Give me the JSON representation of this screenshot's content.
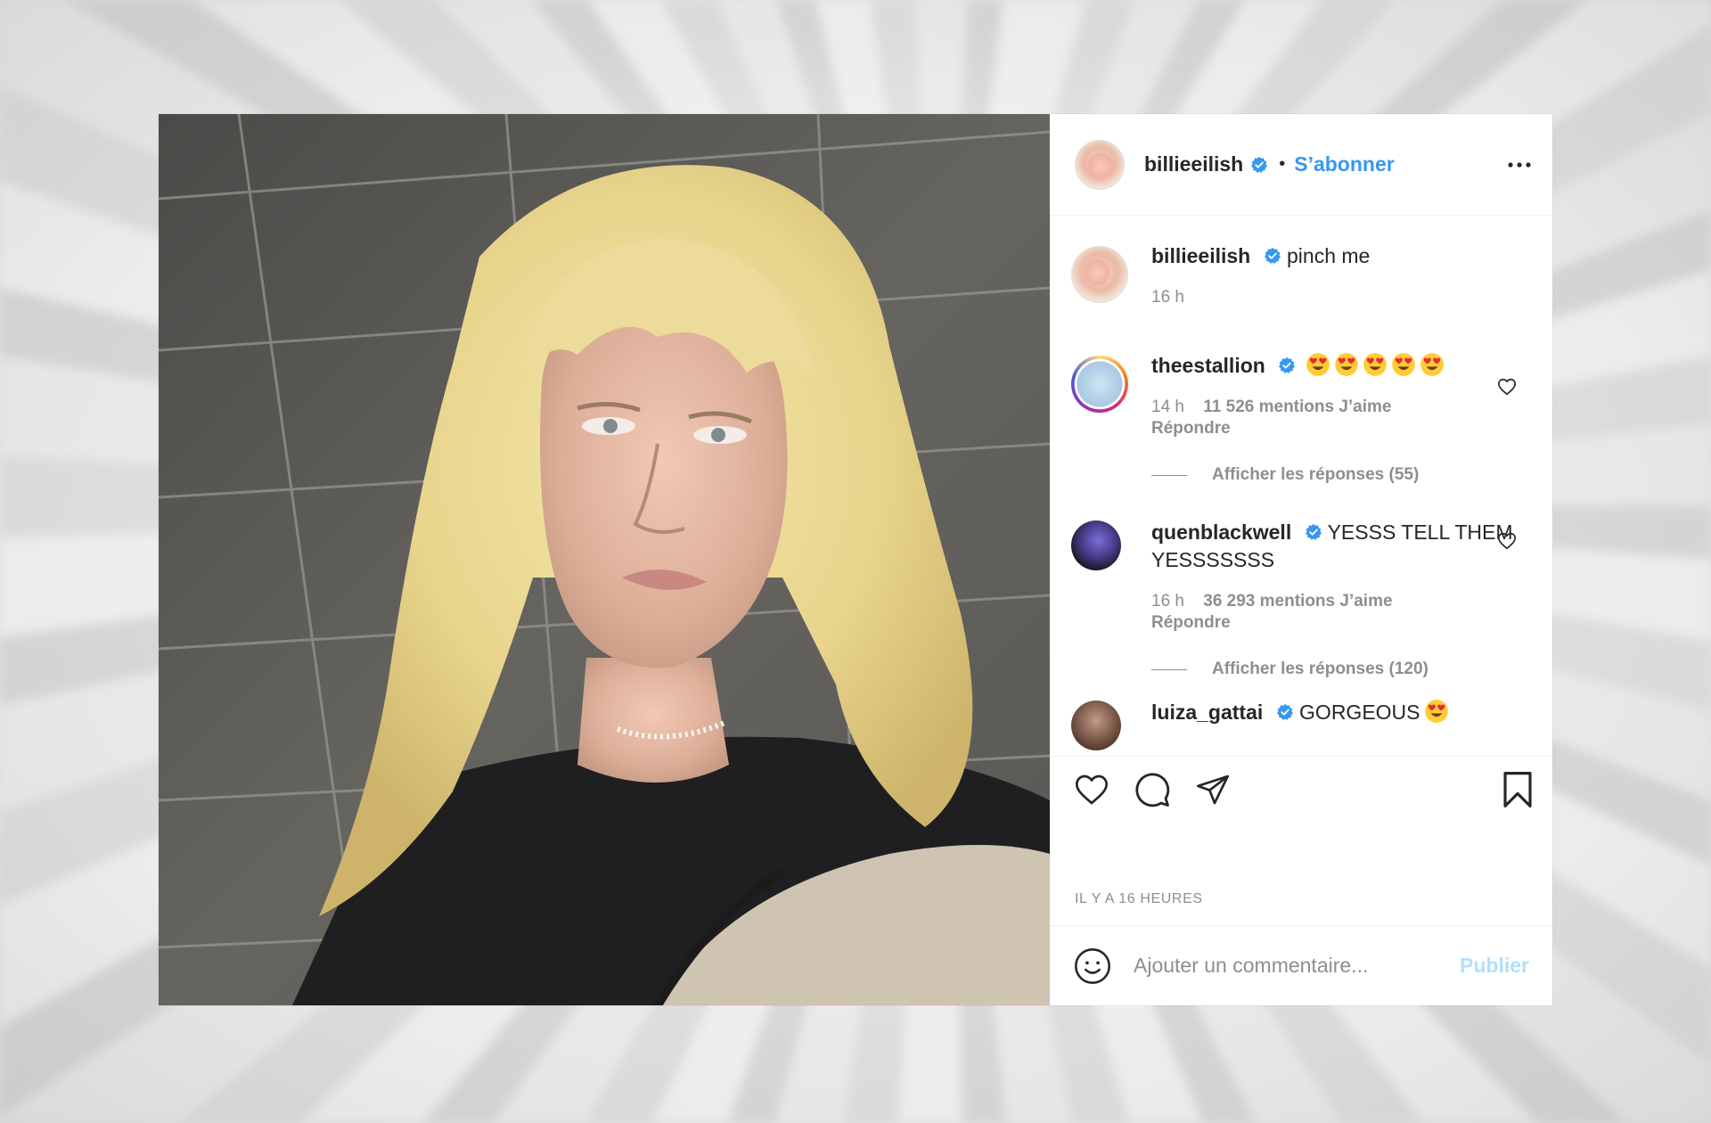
{
  "post": {
    "author": "billieeilish",
    "verified": true,
    "separator": "•",
    "follow_label": "S’abonner",
    "more_label": "Plus d’options"
  },
  "caption": {
    "user": "billieeilish",
    "text": "pinch me",
    "time": "16 h"
  },
  "comments": [
    {
      "user": "theestallion",
      "text": "",
      "emoji": [
        "heart-eyes-emoji",
        "heart-eyes-emoji",
        "heart-eyes-emoji",
        "heart-eyes-emoji",
        "heart-eyes-emoji"
      ],
      "time": "14 h",
      "likes": "11 526 mentions J’aime",
      "reply_label": "Répondre",
      "view_replies": "Afficher les réponses (55)"
    },
    {
      "user": "quenblackwell",
      "text": "YESSS TELL THEM YESSSSSSS",
      "time": "16 h",
      "likes": "36 293 mentions J’aime",
      "reply_label": "Répondre",
      "view_replies": "Afficher les réponses (120)"
    },
    {
      "user": "luiza_gattai",
      "text": "GORGEOUS",
      "emoji": [
        "heart-eyes-emoji"
      ]
    }
  ],
  "actions": {
    "like": "heart-icon",
    "comment": "comment-bubble-icon",
    "share": "paper-plane-icon",
    "save": "bookmark-icon"
  },
  "timestamp": "IL Y A 16 HEURES",
  "composer": {
    "placeholder": "Ajouter un commentaire...",
    "publish_label": "Publier",
    "emoji_icon": "smiley-icon"
  },
  "colors": {
    "link_blue": "#3897f0",
    "publish_disabled": "#b2dffc",
    "text": "#262626",
    "muted": "#8e8e8e",
    "border": "#efefef"
  }
}
